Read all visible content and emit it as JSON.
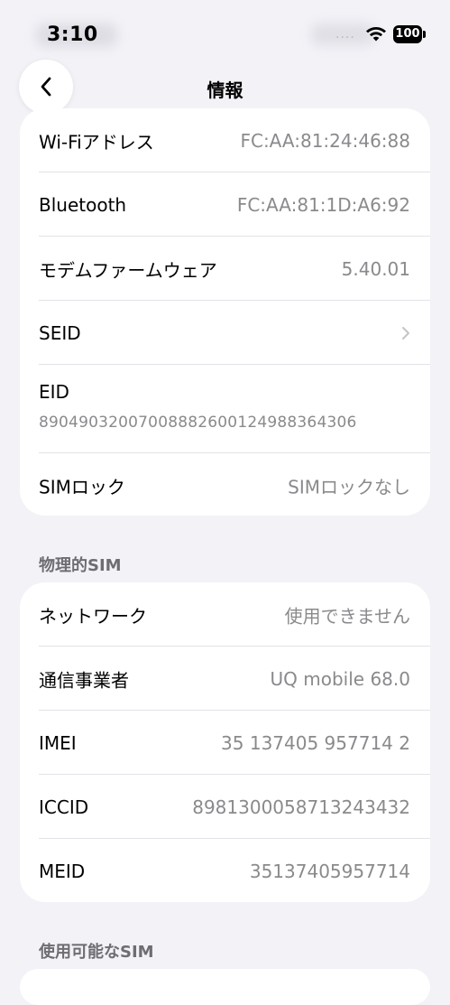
{
  "status_bar": {
    "time": "3:10",
    "battery": "100",
    "dots": "...."
  },
  "nav": {
    "title": "情報"
  },
  "info_rows": [
    {
      "label": "Wi-Fiアドレス",
      "value": "FC:AA:81:24:46:88"
    },
    {
      "label": "Bluetooth",
      "value": "FC:AA:81:1D:A6:92"
    },
    {
      "label": "モデムファームウェア",
      "value": "5.40.01"
    },
    {
      "label": "SEID",
      "value": ""
    },
    {
      "label": "EID",
      "value": "89049032007008882600124988364306"
    },
    {
      "label": "SIMロック",
      "value": "SIMロックなし"
    }
  ],
  "physical_sim": {
    "header": "物理的SIM",
    "rows": [
      {
        "label": "ネットワーク",
        "value": "使用できません"
      },
      {
        "label": "通信事業者",
        "value": "UQ mobile 68.0"
      },
      {
        "label": "IMEI",
        "value": "35 137405 957714 2"
      },
      {
        "label": "ICCID",
        "value": "8981300058713243432"
      },
      {
        "label": "MEID",
        "value": "35137405957714"
      }
    ]
  },
  "available_sim": {
    "header": "使用可能なSIM"
  },
  "icons": {
    "back": "chevron-left-icon",
    "seid_disclosure": "chevron-right-icon",
    "wifi": "wifi-icon"
  },
  "colors": {
    "background": "#f2f2f7",
    "card": "#ffffff",
    "secondary_text": "#8a8a8e",
    "section_header": "#6d6d72"
  }
}
